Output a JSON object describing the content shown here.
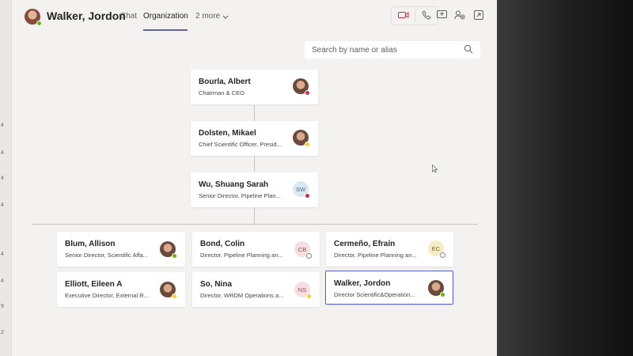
{
  "header": {
    "title": "Walker, Jordon",
    "tabs": [
      {
        "label": "Chat",
        "active": false
      },
      {
        "label": "Organization",
        "active": true
      },
      {
        "label": "2 more",
        "active": false
      }
    ],
    "icons": [
      "video-call-icon",
      "audio-call-icon",
      "share-screen-icon",
      "add-people-icon",
      "pop-out-icon"
    ]
  },
  "search": {
    "placeholder": "Search by name or alias"
  },
  "rail_numbers": [
    "4",
    "4",
    "4",
    "4",
    "4",
    "4",
    "9",
    "2"
  ],
  "chain": [
    {
      "name": "Bourla, Albert",
      "title": "Chairman & CEO",
      "avatar": "photo",
      "presence": "busy"
    },
    {
      "name": "Dolsten, Mikael",
      "title": "Chief Scientific Officer, Presid...",
      "avatar": "photo",
      "presence": "away"
    },
    {
      "name": "Wu, Shuang Sarah",
      "title": "Senior Director, Pipeline Plan...",
      "avatar": "SW",
      "presence": "busy"
    }
  ],
  "peers": [
    {
      "name": "Blum, Allison",
      "title": "Senior Director, Scientific Affa...",
      "avatar": "photo",
      "presence": "available",
      "selected": false
    },
    {
      "name": "Bond, Colin",
      "title": "Director, Pipeline Planning an...",
      "avatar": "CB",
      "presence": "offline",
      "selected": false
    },
    {
      "name": "Cermeño, Efraín",
      "title": "Director, Pipeline Planning an...",
      "avatar": "EC",
      "presence": "offline",
      "selected": false
    },
    {
      "name": "Elliott, Eileen A",
      "title": "Executive Director, External R...",
      "avatar": "photo",
      "presence": "away",
      "selected": false
    },
    {
      "name": "So, Nina",
      "title": "Director, WRDM Operations a...",
      "avatar": "NS",
      "presence": "away",
      "selected": false
    },
    {
      "name": "Walker, Jordon",
      "title": "Director Scientific&Operation...",
      "avatar": "photo",
      "presence": "available",
      "selected": true
    }
  ],
  "colors": {
    "accent": "#6264a7",
    "available": "#6bb700",
    "busy": "#c4314b",
    "away": "#f8d22a",
    "offline": "#8a8886"
  }
}
